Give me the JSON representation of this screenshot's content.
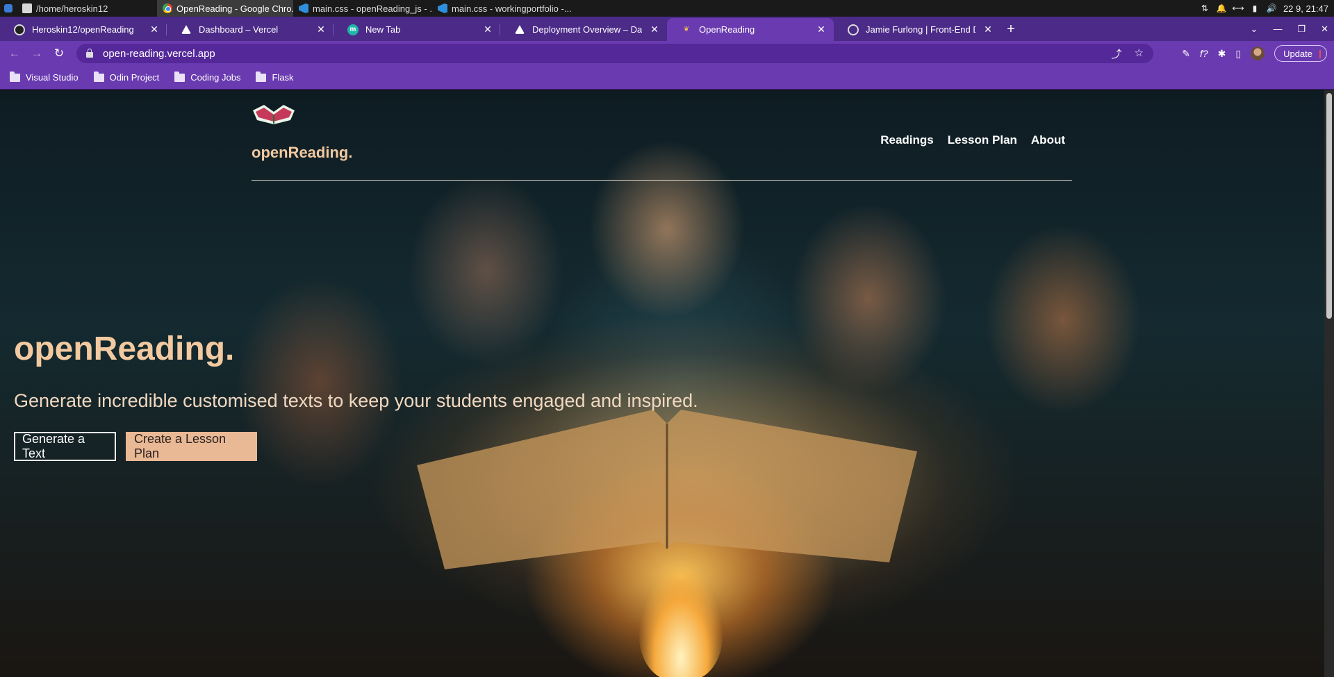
{
  "os": {
    "tasks": [
      {
        "label": "/home/heroskin12",
        "icon": "folder-icon",
        "active": false
      },
      {
        "label": "OpenReading - Google Chro...",
        "icon": "chrome-icon",
        "active": true
      },
      {
        "label": "main.css - openReading_js - ...",
        "icon": "vscode-icon",
        "active": false
      },
      {
        "label": "main.css - workingportfolio -...",
        "icon": "vscode-icon",
        "active": false
      }
    ],
    "clock": "22 9, 21:47"
  },
  "browser": {
    "tabs": [
      {
        "label": "Heroskin12/openReading",
        "icon": "github-icon"
      },
      {
        "label": "Dashboard – Vercel",
        "icon": "vercel-icon"
      },
      {
        "label": "New Tab",
        "icon": "m-icon"
      },
      {
        "label": "Deployment Overview – Dashb...",
        "icon": "vercel-icon"
      },
      {
        "label": "OpenReading",
        "icon": "openreading-icon",
        "active": true
      },
      {
        "label": "Jamie Furlong | Front-End Deve...",
        "icon": "globe-icon"
      }
    ],
    "url": "open-reading.vercel.app",
    "update_label": "Update",
    "bookmarks": [
      "Visual Studio",
      "Odin Project",
      "Coding Jobs",
      "Flask"
    ],
    "accent": "#6a3ab0"
  },
  "site": {
    "brand": "openReading.",
    "nav": [
      "Readings",
      "Lesson Plan",
      "About"
    ],
    "hero_title": "openReading.",
    "hero_subtitle": "Generate incredible customised texts to keep your students engaged and inspired.",
    "primary_button": "Generate a Text",
    "secondary_button": "Create a Lesson Plan",
    "brand_color": "#f2c9a0"
  }
}
